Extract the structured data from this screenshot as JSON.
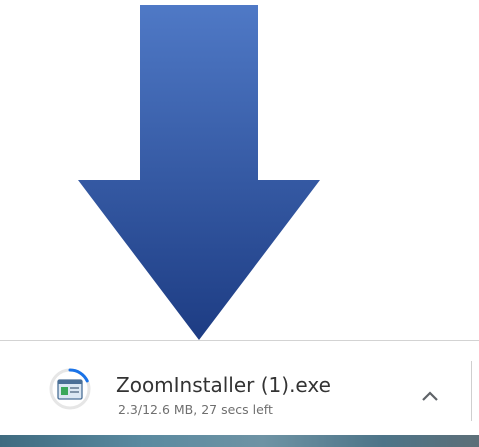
{
  "colors": {
    "arrow_light": "#4f79c6",
    "arrow_dark": "#1d3c83",
    "progress_ring": "#1a73e8",
    "text_primary": "#333333",
    "text_secondary": "#6f6f6f"
  },
  "download": {
    "file_name": "ZoomInstaller (1).exe",
    "status": "2.3/12.6 MB, 27 secs left",
    "progress": 0.18,
    "file_icon": "installer-file-icon",
    "more_icon": "chevron-up-icon"
  }
}
